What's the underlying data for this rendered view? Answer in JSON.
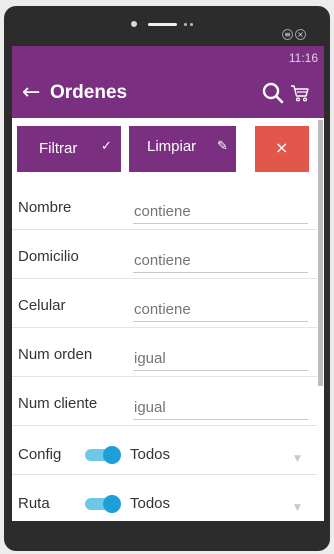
{
  "status": {
    "time": "11:16"
  },
  "appbar": {
    "title": "Ordenes",
    "back_icon": "arrow-left-icon",
    "search_icon": "search-icon",
    "cart_icon": "cart-icon"
  },
  "actions": {
    "filter_label": "Filtrar",
    "clear_label": "Limpiar",
    "close_icon": "close-icon"
  },
  "fields": [
    {
      "label": "Nombre",
      "placeholder": "contiene"
    },
    {
      "label": "Domicilio",
      "placeholder": "contiene"
    },
    {
      "label": "Celular",
      "placeholder": "contiene"
    },
    {
      "label": "Num orden",
      "placeholder": "igual"
    },
    {
      "label": "Num cliente",
      "placeholder": "igual"
    }
  ],
  "selects": [
    {
      "label": "Config",
      "value": "Todos",
      "toggle_on": true
    },
    {
      "label": "Ruta",
      "value": "Todos",
      "toggle_on": true
    }
  ],
  "colors": {
    "primary": "#7b2f81",
    "danger": "#e2564c",
    "toggle": "#1da0d8"
  }
}
